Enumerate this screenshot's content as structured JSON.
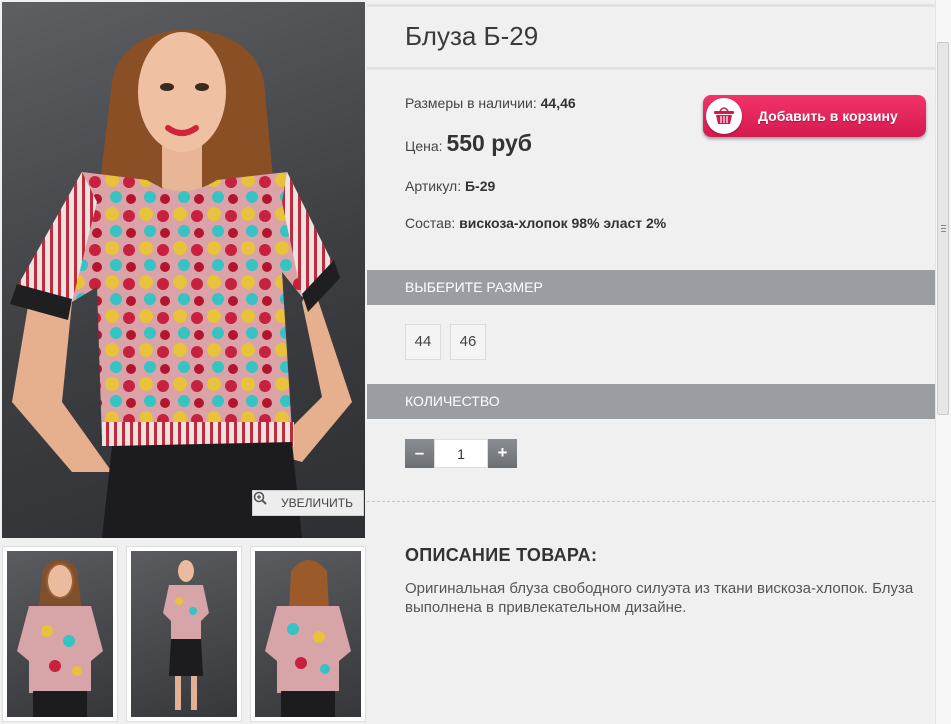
{
  "product": {
    "title": "Блуза Б-29",
    "sizes_label": "Размеры в наличии:",
    "sizes_value": "44,46",
    "price_label": "Цена:",
    "price_value": "550 руб",
    "article_label": "Артикул:",
    "article_value": "Б-29",
    "composition_label": "Состав:",
    "composition_value": "вискоза-хлопок 98% эласт 2%"
  },
  "cart_button": {
    "label": "Добавить в корзину",
    "icon": "basket-icon"
  },
  "gallery": {
    "zoom_label": "УВЕЛИЧИТЬ",
    "zoom_icon": "magnifier-plus-icon"
  },
  "size_section": {
    "title": "ВЫБЕРИТЕ РАЗМЕР",
    "options": [
      "44",
      "46"
    ]
  },
  "quantity_section": {
    "title": "КОЛИЧЕСТВО",
    "minus_label": "–",
    "plus_label": "+",
    "value": "1"
  },
  "description": {
    "heading": "ОПИСАНИЕ ТОВАРА:",
    "text": "Оригинальная блуза свободного силуэта из ткани вискоза-хлопок. Блуза выполнена в привлекательном дизайне."
  },
  "colors": {
    "accent": "#e0245a",
    "section_bar": "#9a9ea3",
    "background": "#f0f0f0"
  }
}
